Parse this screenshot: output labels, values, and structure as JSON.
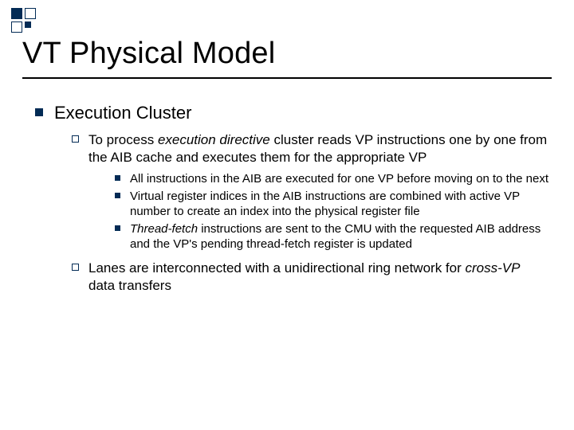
{
  "title": "VT Physical Model",
  "lvl1": {
    "text": "Execution Cluster"
  },
  "lvl2a": {
    "pre": "To process ",
    "em": "execution directive",
    "post": " cluster reads VP instructions one by one from the AIB cache and executes them for the appropriate VP"
  },
  "lvl3a": "All instructions in the AIB are executed for one VP before moving on to the next",
  "lvl3b": "Virtual register indices in the AIB instructions are combined with active VP number to create an index into the physical register file",
  "lvl3c": {
    "em": "Thread-fetch",
    "post": " instructions are sent to the CMU with the requested AIB address and the VP's pending thread-fetch register is updated"
  },
  "lvl2b": {
    "pre": "Lanes are interconnected with a unidirectional ring network for ",
    "em": "cross-VP",
    "post": " data transfers"
  }
}
